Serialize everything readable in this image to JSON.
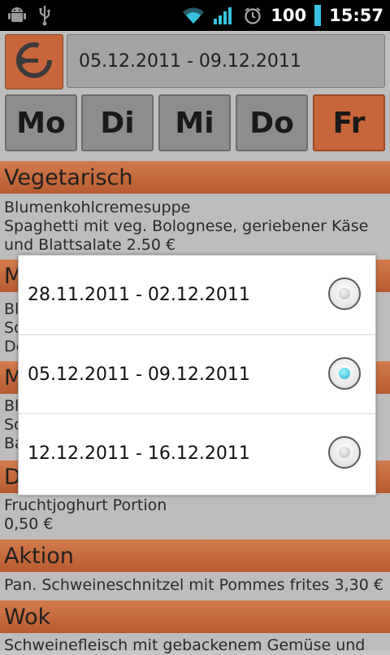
{
  "status_bar": {
    "battery": "100",
    "time": "15:57",
    "icons": [
      "android-debug-icon",
      "usb-icon",
      "wifi-icon",
      "signal-icon",
      "alarm-icon",
      "battery-icon"
    ]
  },
  "header": {
    "week_range": "05.12.2011 - 09.12.2011",
    "refresh_icon": "refresh-icon"
  },
  "days": [
    {
      "label": "Mo",
      "active": false
    },
    {
      "label": "Di",
      "active": false
    },
    {
      "label": "Mi",
      "active": false
    },
    {
      "label": "Do",
      "active": false
    },
    {
      "label": "Fr",
      "active": true
    }
  ],
  "sections": [
    {
      "title": "Vegetarisch",
      "lines": [
        "Blumenkohlcremesuppe",
        "Spaghetti mit veg. Bolognese, geriebener Käse",
        "und Blattsalate 2.50 €"
      ]
    },
    {
      "title": "M",
      "lines": [
        "Bl",
        "So",
        "De"
      ]
    },
    {
      "title": "M",
      "lines": [
        "Bl",
        "So",
        "Ba"
      ]
    },
    {
      "title": "D",
      "lines": [
        "Fruchtjoghurt Portion",
        "0,50 €"
      ]
    },
    {
      "title": "Aktion",
      "lines": [
        "Pan. Schweineschnitzel mit Pommes frites 3,30 €"
      ]
    },
    {
      "title": "Wok",
      "lines": [
        "Schweinefleisch mit gebackenem Gemüse und"
      ]
    }
  ],
  "dialog": {
    "options": [
      {
        "label": "28.11.2011 - 02.12.2011",
        "selected": false
      },
      {
        "label": "05.12.2011 - 09.12.2011",
        "selected": true
      },
      {
        "label": "12.12.2011 - 16.12.2011",
        "selected": false
      }
    ]
  },
  "colors": {
    "accent": "#c8653a",
    "radio_selected": "#1fb3cf",
    "background": "#bdbdbd"
  }
}
